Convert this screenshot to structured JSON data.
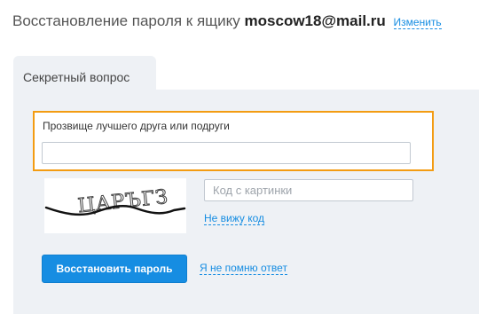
{
  "header": {
    "title": "Восстановление пароля к ящику",
    "email": "moscow18@mail.ru",
    "change_link": "Изменить"
  },
  "tab": {
    "label": "Секретный вопрос"
  },
  "question": {
    "label": "Прозвище лучшего друга или подруги",
    "answer_value": ""
  },
  "captcha": {
    "image_text": "ЦАРЪГЗ",
    "input_placeholder": "Код с картинки",
    "no_code_link": "Не вижу код"
  },
  "actions": {
    "restore_button": "Восстановить пароль",
    "forgot_link": "Я не помню ответ"
  },
  "colors": {
    "accent": "#168de2",
    "highlight": "#f39c12",
    "panel": "#eef1f5"
  }
}
